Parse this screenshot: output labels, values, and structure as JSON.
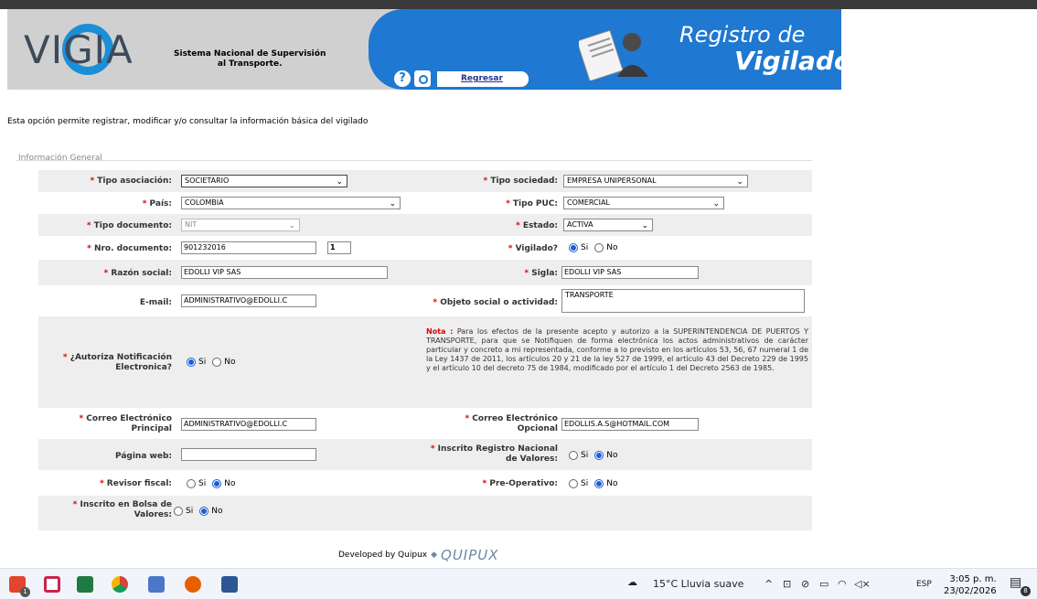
{
  "header": {
    "logo": "VIGIA",
    "subtitle_line1": "Sistema Nacional de Supervisión",
    "subtitle_line2": "al Transporte.",
    "help": "?",
    "back_link": "Regresar",
    "module_line1": "Registro de",
    "module_line2": "Vigilados"
  },
  "intro": "Esta opción permite registrar, modificar y/o consultar la información básica del vigilado",
  "fieldset_legend": "Información General",
  "form": {
    "tipo_asociacion": {
      "label": "Tipo asociación:",
      "value": "SOCIETARIO"
    },
    "tipo_sociedad": {
      "label": "Tipo sociedad:",
      "value": "EMPRESA UNIPERSONAL"
    },
    "pais": {
      "label": "País:",
      "value": "COLOMBIA"
    },
    "tipo_puc": {
      "label": "Tipo PUC:",
      "value": "COMERCIAL"
    },
    "tipo_documento": {
      "label": "Tipo documento:",
      "value": "NIT"
    },
    "estado": {
      "label": "Estado:",
      "value": "ACTIVA"
    },
    "nro_documento": {
      "label": "Nro. documento:",
      "value": "901232016",
      "dv": "1"
    },
    "vigilado": {
      "label": "Vigilado?",
      "si": "Si",
      "no": "No",
      "selected": "Si"
    },
    "razon_social": {
      "label": "Razón social:",
      "value": "EDOLLI VIP SAS"
    },
    "sigla": {
      "label": "Sigla:",
      "value": "EDOLLI VIP SAS"
    },
    "email": {
      "label": "E-mail:",
      "value": "ADMINISTRATIVO@EDOLLI.C"
    },
    "objeto_social": {
      "label": "Objeto social o actividad:",
      "value": "TRANSPORTE"
    },
    "autoriza": {
      "label_line1": "¿Autoriza Notificación",
      "label_line2": "Electronica?",
      "si": "Si",
      "no": "No",
      "selected": "Si"
    },
    "nota_title": "Nota :",
    "nota_text": "Para los efectos de la presente acepto y autorizo a la SUPERINTENDENCIA DE PUERTOS Y TRANSPORTE, para que se Notifiquen de forma electrónica los actos administrativos de carácter particular y concreto a mi representada, conforme a lo previsto en los artículos 53, 56, 67 numeral 1 de la Ley 1437 de 2011, los artículos 20 y 21 de la ley 527 de 1999, el artículo 43 del Decreto 229 de 1995 y el artículo 10 del decreto 75 de 1984, modificado por el artículo 1 del Decreto 2563 de 1985.",
    "correo_principal": {
      "label_line1": "Correo Electrónico",
      "label_line2": "Principal",
      "value": "ADMINISTRATIVO@EDOLLI.C"
    },
    "correo_opcional": {
      "label_line1": "Correo Electrónico",
      "label_line2": "Opcional",
      "value": "EDOLLIS.A.S@HOTMAIL.COM"
    },
    "pagina_web": {
      "label": "Página web:",
      "value": ""
    },
    "registro_nacional": {
      "label_line1": "Inscrito Registro Nacional",
      "label_line2": "de Valores:",
      "si": "Si",
      "no": "No",
      "selected": "No"
    },
    "revisor_fiscal": {
      "label": "Revisor fiscal:",
      "si": "Si",
      "no": "No",
      "selected": "No"
    },
    "pre_operativo": {
      "label": "Pre-Operativo:",
      "si": "Si",
      "no": "No",
      "selected": "No"
    },
    "bolsa_valores": {
      "label_line1": "Inscrito en Bolsa de",
      "label_line2": "Valores:",
      "si": "Si",
      "no": "No",
      "selected": "No"
    }
  },
  "footer": {
    "text": "Developed by Quipux",
    "brand": "QUIPUX"
  },
  "taskbar": {
    "weather": "15°C  Lluvia suave",
    "lang": "ESP",
    "time": "3:05 p. m.",
    "date": "23/02/2026",
    "notifications": "8",
    "badge_app": "1"
  }
}
